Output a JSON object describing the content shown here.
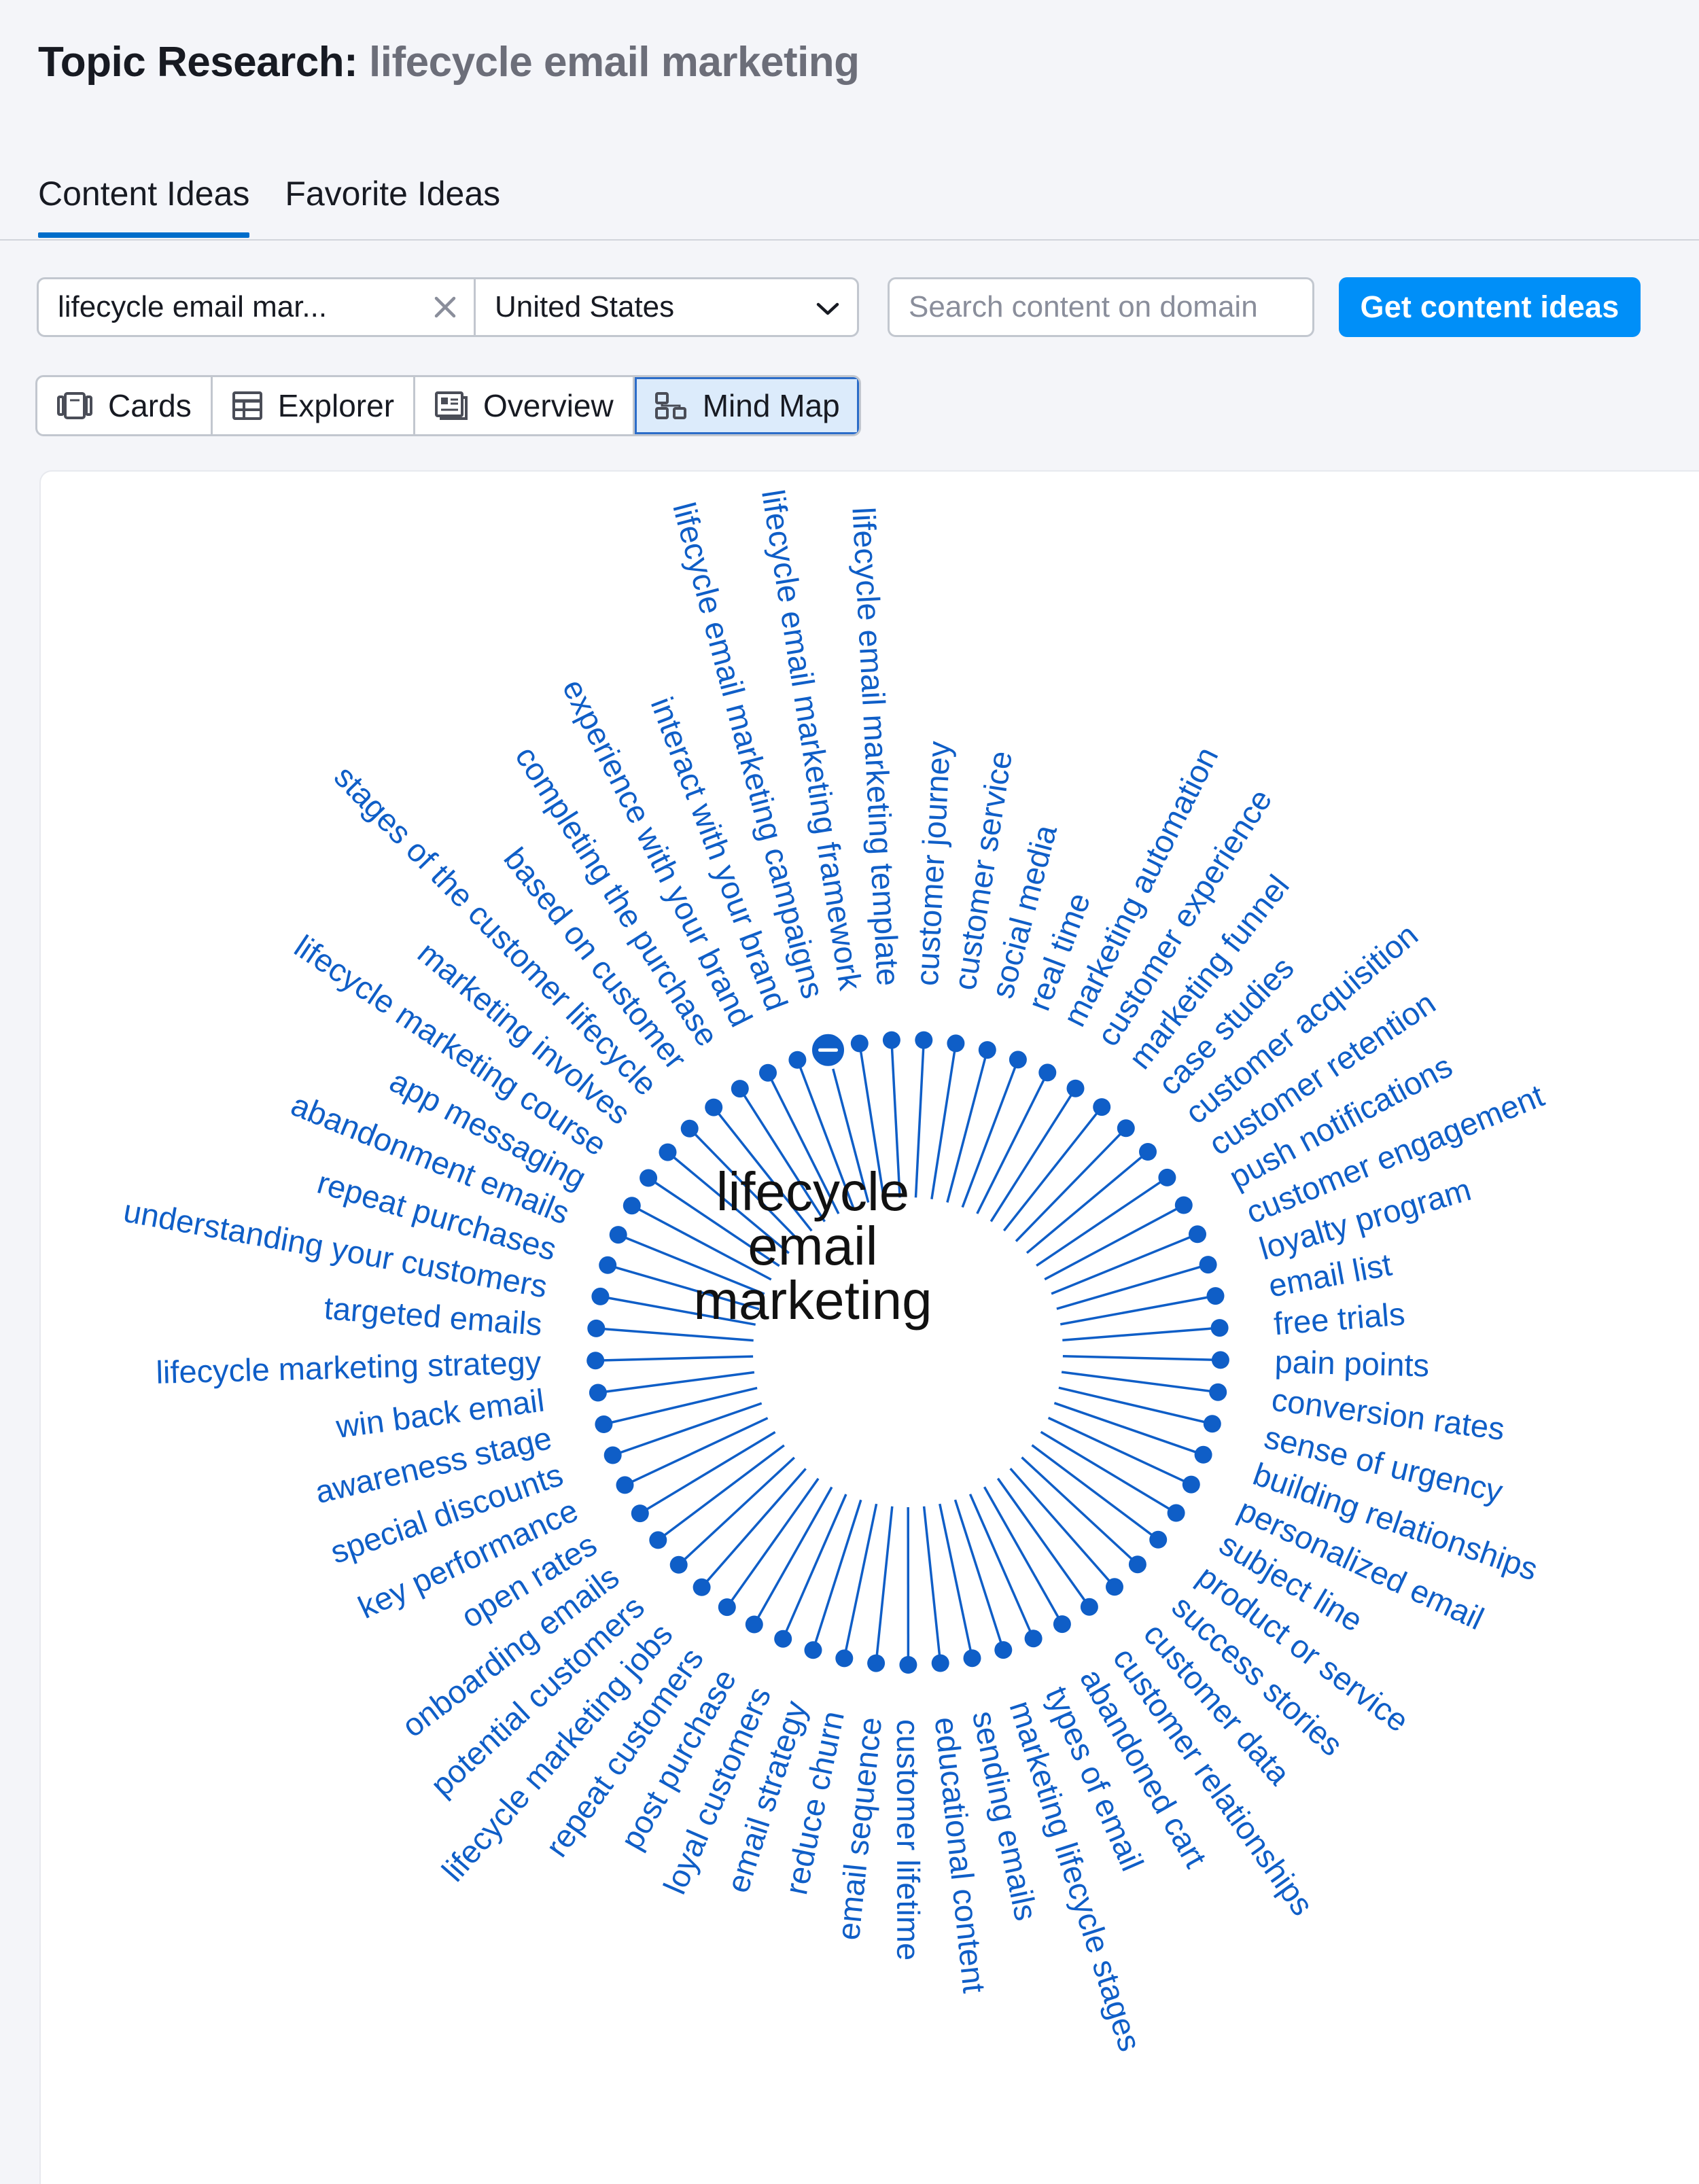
{
  "header": {
    "title_prefix": "Topic Research:",
    "title_query": "lifecycle email marketing"
  },
  "tabs": [
    {
      "label": "Content Ideas",
      "active": true
    },
    {
      "label": "Favorite Ideas",
      "active": false
    }
  ],
  "search": {
    "query_value": "lifecycle email mar...",
    "country_value": "United States",
    "domain_placeholder": "Search content on domain",
    "submit_label": "Get content ideas"
  },
  "views": [
    {
      "label": "Cards",
      "icon": "cards-icon",
      "active": false
    },
    {
      "label": "Explorer",
      "icon": "table-icon",
      "active": false
    },
    {
      "label": "Overview",
      "icon": "overview-icon",
      "active": false
    },
    {
      "label": "Mind Map",
      "icon": "mindmap-icon",
      "active": true
    }
  ],
  "mindmap": {
    "center": "lifecycle\nemail\nmarketing",
    "branches": [
      "lifecycle email marketing template",
      "customer journey",
      "customer service",
      "social media",
      "real time",
      "marketing automation",
      "customer experience",
      "marketing funnel",
      "case studies",
      "customer acquisition",
      "customer retention",
      "push notifications",
      "customer engagement",
      "loyalty program",
      "email list",
      "free trials",
      "pain points",
      "conversion rates",
      "sense of urgency",
      "building relationships",
      "personalized email",
      "subject line",
      "product or service",
      "success stories",
      "customer data",
      "customer relationships",
      "abandoned cart",
      "types of email",
      "marketing lifecycle stages",
      "sending emails",
      "educational content",
      "customer lifetime",
      "email sequence",
      "reduce churn",
      "email strategy",
      "loyal customers",
      "post purchase",
      "repeat customers",
      "lifecycle marketing jobs",
      "potential customers",
      "onboarding emails",
      "open rates",
      "key performance",
      "special discounts",
      "awareness stage",
      "win back email",
      "lifecycle marketing strategy",
      "targeted emails",
      "understanding your customers",
      "repeat purchases",
      "abandonment emails",
      "app messaging",
      "lifecycle marketing course",
      "marketing involves",
      "stages of the customer lifecycle",
      "based on customer",
      "completing the purchase",
      "experience with your brand",
      "interact with your brand",
      "lifecycle email marketing campaigns",
      "lifecycle email marketing framework"
    ],
    "colors": {
      "node": "#0f5ec7",
      "label": "#0f5ec7"
    },
    "collapse_icon": "minus-circle-icon"
  },
  "colors": {
    "accent": "#008ff8",
    "active_tab_underline": "#006dca",
    "active_view_background": "#dcebfb"
  }
}
